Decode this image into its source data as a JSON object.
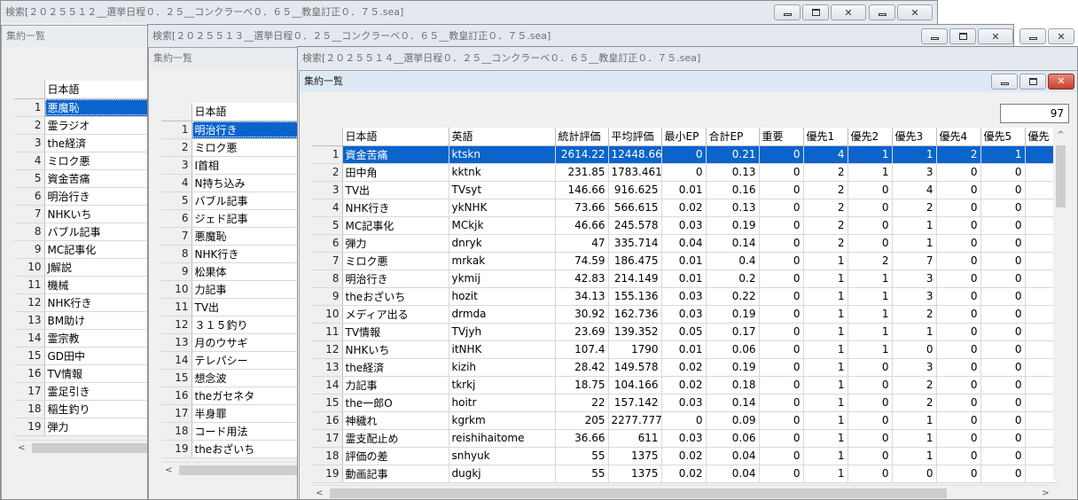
{
  "win1": {
    "title": "検索[２０２５５１２__選挙日程０．２５__コンクラーベ０．６５__教皇訂正０．７５.sea]",
    "child_title": "集約一覧",
    "header": "日本語",
    "rows": [
      {
        "n": "1",
        "jp": "悪魔恥"
      },
      {
        "n": "2",
        "jp": "霊ラジオ"
      },
      {
        "n": "3",
        "jp": "the経済"
      },
      {
        "n": "4",
        "jp": "ミロク悪"
      },
      {
        "n": "5",
        "jp": "資金苦痛"
      },
      {
        "n": "6",
        "jp": "明治行き"
      },
      {
        "n": "7",
        "jp": "NHKいち"
      },
      {
        "n": "8",
        "jp": "バブル記事"
      },
      {
        "n": "9",
        "jp": "MC記事化"
      },
      {
        "n": "10",
        "jp": "J解説"
      },
      {
        "n": "11",
        "jp": "機械"
      },
      {
        "n": "12",
        "jp": "NHK行き"
      },
      {
        "n": "13",
        "jp": "BM助け"
      },
      {
        "n": "14",
        "jp": "霊宗教"
      },
      {
        "n": "15",
        "jp": "GD田中"
      },
      {
        "n": "16",
        "jp": "TV情報"
      },
      {
        "n": "17",
        "jp": "霊足引き"
      },
      {
        "n": "18",
        "jp": "稲生釣り"
      },
      {
        "n": "19",
        "jp": "弾力"
      }
    ]
  },
  "win2": {
    "title": "検索[２０２５５１３__選挙日程０．２５__コンクラーベ０．６５__教皇訂正０．７５.sea]",
    "child_title": "集約一覧",
    "header": "日本語",
    "rows": [
      {
        "n": "1",
        "jp": "明治行き"
      },
      {
        "n": "2",
        "jp": "ミロク悪"
      },
      {
        "n": "3",
        "jp": "I首相"
      },
      {
        "n": "4",
        "jp": "N持ち込み"
      },
      {
        "n": "5",
        "jp": "バブル記事"
      },
      {
        "n": "6",
        "jp": "ジェド記事"
      },
      {
        "n": "7",
        "jp": "悪魔恥"
      },
      {
        "n": "8",
        "jp": "NHK行き"
      },
      {
        "n": "9",
        "jp": "松果体"
      },
      {
        "n": "10",
        "jp": "力記事"
      },
      {
        "n": "11",
        "jp": "TV出"
      },
      {
        "n": "12",
        "jp": "３１５釣り"
      },
      {
        "n": "13",
        "jp": "月のウサギ"
      },
      {
        "n": "14",
        "jp": "テレパシー"
      },
      {
        "n": "15",
        "jp": "想念波"
      },
      {
        "n": "16",
        "jp": "theガセネタ"
      },
      {
        "n": "17",
        "jp": "半身罪"
      },
      {
        "n": "18",
        "jp": "コード用法"
      },
      {
        "n": "19",
        "jp": "theおざいち"
      }
    ]
  },
  "win3": {
    "title": "検索[２０２５５１４__選挙日程０．２５__コンクラーベ０．６５__教皇訂正０．７５.sea]",
    "child_title": "集約一覧",
    "count": "97",
    "columns": [
      "日本語",
      "英語",
      "統計評価",
      "平均評価",
      "最小EP",
      "合計EP",
      "重要",
      "優先1",
      "優先2",
      "優先3",
      "優先4",
      "優先5",
      "優先"
    ],
    "rows": [
      [
        "1",
        "資金苦痛",
        "ktskn",
        "2614.22",
        "12448.666",
        "0",
        "0.21",
        "0",
        "4",
        "1",
        "1",
        "2",
        "1",
        ""
      ],
      [
        "2",
        "田中角",
        "kktnk",
        "231.85",
        "1783.461",
        "0",
        "0.13",
        "0",
        "2",
        "1",
        "3",
        "0",
        "0",
        ""
      ],
      [
        "3",
        "TV出",
        "TVsyt",
        "146.66",
        "916.625",
        "0.01",
        "0.16",
        "0",
        "2",
        "0",
        "4",
        "0",
        "0",
        ""
      ],
      [
        "4",
        "NHK行き",
        "ykNHK",
        "73.66",
        "566.615",
        "0.02",
        "0.13",
        "0",
        "2",
        "0",
        "2",
        "0",
        "0",
        ""
      ],
      [
        "5",
        "MC記事化",
        "MCkjk",
        "46.66",
        "245.578",
        "0.03",
        "0.19",
        "0",
        "2",
        "0",
        "1",
        "0",
        "0",
        ""
      ],
      [
        "6",
        "弾力",
        "dnryk",
        "47",
        "335.714",
        "0.04",
        "0.14",
        "0",
        "2",
        "0",
        "1",
        "0",
        "0",
        ""
      ],
      [
        "7",
        "ミロク悪",
        "mrkak",
        "74.59",
        "186.475",
        "0.01",
        "0.4",
        "0",
        "1",
        "2",
        "7",
        "0",
        "0",
        ""
      ],
      [
        "8",
        "明治行き",
        "ykmij",
        "42.83",
        "214.149",
        "0.01",
        "0.2",
        "0",
        "1",
        "1",
        "3",
        "0",
        "0",
        ""
      ],
      [
        "9",
        "theおざいち",
        "hozit",
        "34.13",
        "155.136",
        "0.03",
        "0.22",
        "0",
        "1",
        "1",
        "3",
        "0",
        "0",
        ""
      ],
      [
        "10",
        "メディア出る",
        "drmda",
        "30.92",
        "162.736",
        "0.03",
        "0.19",
        "0",
        "1",
        "1",
        "2",
        "0",
        "0",
        ""
      ],
      [
        "11",
        "TV情報",
        "TVjyh",
        "23.69",
        "139.352",
        "0.05",
        "0.17",
        "0",
        "1",
        "1",
        "1",
        "0",
        "0",
        ""
      ],
      [
        "12",
        "NHKいち",
        "itNHK",
        "107.4",
        "1790",
        "0.01",
        "0.06",
        "0",
        "1",
        "1",
        "0",
        "0",
        "0",
        ""
      ],
      [
        "13",
        "the経済",
        "kizih",
        "28.42",
        "149.578",
        "0.02",
        "0.19",
        "0",
        "1",
        "0",
        "3",
        "0",
        "0",
        ""
      ],
      [
        "14",
        "力記事",
        "tkrkj",
        "18.75",
        "104.166",
        "0.02",
        "0.18",
        "0",
        "1",
        "0",
        "2",
        "0",
        "0",
        ""
      ],
      [
        "15",
        "the一郎O",
        "hoitr",
        "22",
        "157.142",
        "0.03",
        "0.14",
        "0",
        "1",
        "0",
        "2",
        "0",
        "0",
        ""
      ],
      [
        "16",
        "神穢れ",
        "kgrkm",
        "205",
        "2277.777",
        "0",
        "0.09",
        "0",
        "1",
        "0",
        "1",
        "0",
        "0",
        ""
      ],
      [
        "17",
        "霊支配止め",
        "reishihaitome",
        "36.66",
        "611",
        "0.03",
        "0.06",
        "0",
        "1",
        "0",
        "1",
        "0",
        "0",
        ""
      ],
      [
        "18",
        "評価の差",
        "snhyuk",
        "55",
        "1375",
        "0.02",
        "0.04",
        "0",
        "1",
        "0",
        "1",
        "0",
        "0",
        ""
      ],
      [
        "19",
        "動画記事",
        "dugkj",
        "55",
        "1375",
        "0.02",
        "0.04",
        "0",
        "1",
        "0",
        "0",
        "0",
        "0",
        ""
      ]
    ]
  },
  "scroll_arrows": {
    "left": "<",
    "right": ">",
    "up": "^",
    "down": "v"
  },
  "colors": {
    "selection": "#0a64cc",
    "close_button": "#c6402c"
  }
}
